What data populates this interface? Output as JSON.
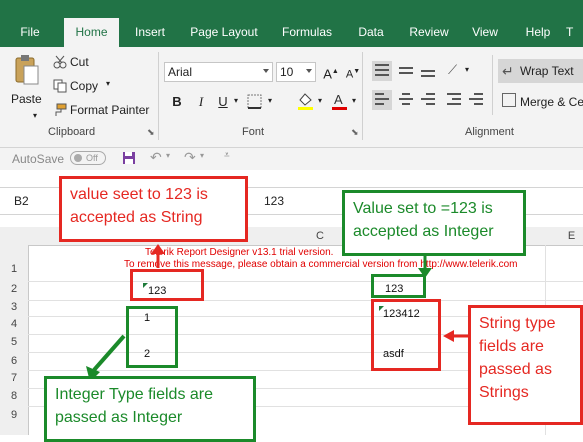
{
  "menu": {
    "tabs": [
      "File",
      "Home",
      "Insert",
      "Page Layout",
      "Formulas",
      "Data",
      "Review",
      "View",
      "Help",
      "T"
    ],
    "active": "Home"
  },
  "ribbon": {
    "clipboard": {
      "paste": "Paste",
      "cut": "Cut",
      "copy": "Copy",
      "format_painter": "Format Painter",
      "label": "Clipboard"
    },
    "font": {
      "family": "Arial",
      "size": "10",
      "bold": "B",
      "italic": "I",
      "underline": "U",
      "grow": "A",
      "shrink": "A",
      "label": "Font"
    },
    "alignment": {
      "wrap_text": "Wrap Text",
      "merge": "Merge & Ce",
      "label": "Alignment"
    }
  },
  "qat": {
    "autosave": "AutoSave",
    "toggle": "Off"
  },
  "formula_bar": {
    "name_box": "B2",
    "value": "123"
  },
  "columns": [
    "C",
    "E"
  ],
  "rows": [
    "1",
    "2",
    "3",
    "4",
    "5",
    "6",
    "7",
    "8",
    "9"
  ],
  "cells": {
    "trial_line1": "Telerik Report Designer v13.1 trial version.",
    "trial_line2": "To remove this message, please obtain a commercial version from http://www.telerik.com",
    "b2": "123",
    "b4": "1",
    "b6": "2",
    "d2": "123",
    "d4": "123412",
    "d6": "asdf"
  },
  "callouts": {
    "string_value": "value seet to 123 is accepted as String",
    "integer_value": "Value set to =123 is accepted as Integer",
    "integer_fields": "Integer Type fields are passed as Integer",
    "string_fields": "String type fields are passed as Strings"
  },
  "colors": {
    "excel_green": "#217346",
    "callout_red": "#e52822",
    "callout_green": "#1b8a2a",
    "trial_red": "#e00000"
  }
}
